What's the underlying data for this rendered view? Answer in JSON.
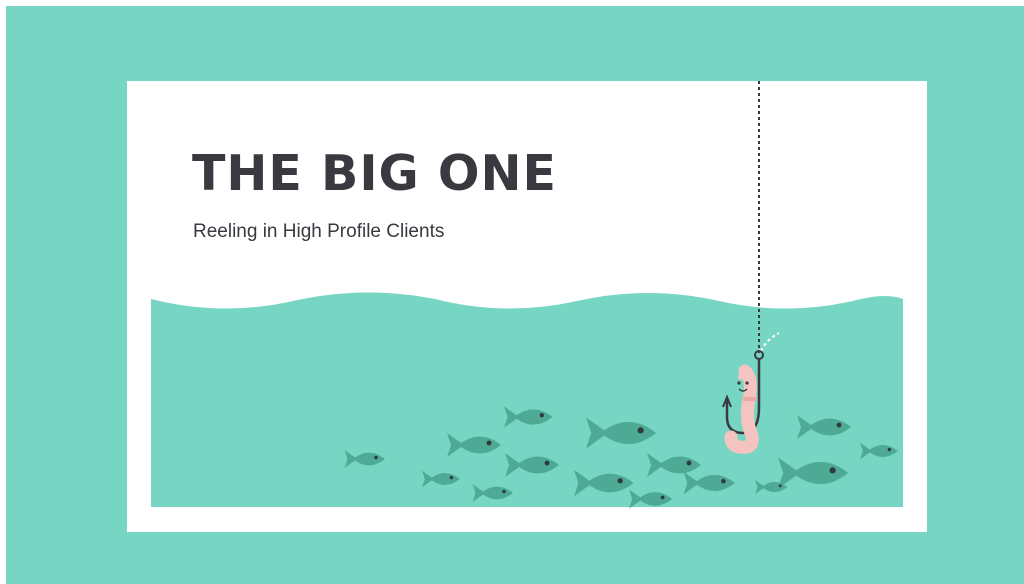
{
  "slide": {
    "title": "THE BIG ONE",
    "subtitle": "Reeling in High Profile Clients"
  },
  "icons": [
    "fishing-line-icon",
    "fishing-hook-icon",
    "worm-icon",
    "fish-icon",
    "water-wave-icon"
  ],
  "colors": {
    "background": "#76d6c3",
    "card": "#ffffff",
    "water": "#76d6c3",
    "fish": "#4faa95",
    "fish_eye": "#2f3a3a",
    "title_text": "#3a3940",
    "worm": "#f6c4c0",
    "hook": "#3a3940"
  }
}
